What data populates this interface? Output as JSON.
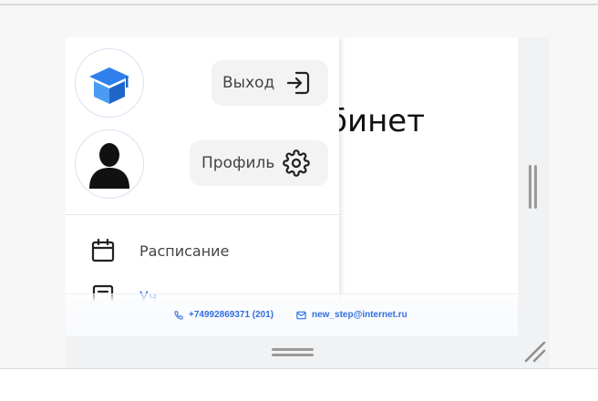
{
  "page": {
    "heading_visible": "бинет"
  },
  "menu": {
    "logout_label": "Выход",
    "profile_label": "Профиль",
    "items": [
      {
        "label": "Расписание",
        "icon": "calendar-icon"
      },
      {
        "label": "Уч",
        "icon": "journal-icon"
      }
    ]
  },
  "footer": {
    "phone": "+74992869371 (201)",
    "email": "new_step@internet.ru"
  },
  "colors": {
    "accent": "#2f6fe0",
    "logo_blue": "#2f80ed",
    "button_bg": "#f3f3f3",
    "text": "#444444"
  }
}
